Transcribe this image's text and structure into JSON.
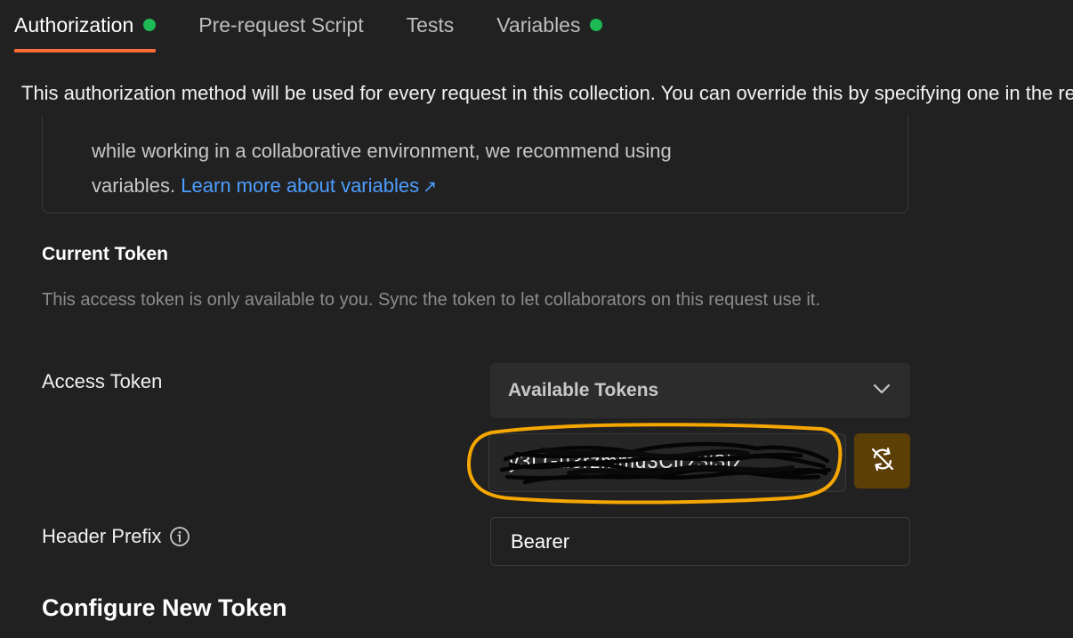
{
  "tabs": [
    {
      "label": "Authorization",
      "active": true,
      "has_dot": true
    },
    {
      "label": "Pre-request Script",
      "active": false,
      "has_dot": false
    },
    {
      "label": "Tests",
      "active": false,
      "has_dot": false
    },
    {
      "label": "Variables",
      "active": false,
      "has_dot": true
    }
  ],
  "info_text": "This authorization method will be used for every request in this collection. You can override this by specifying one in the request.",
  "notice": {
    "line1": "while working in a collaborative environment, we recommend using",
    "line2_prefix": "variables.",
    "link_text": "Learn more about variables",
    "link_arrow": "↗"
  },
  "current_token": {
    "title": "Current Token",
    "description": "This access token is only available to you. Sync the token to let collaborators on this request use it."
  },
  "access_token": {
    "label": "Access Token",
    "dropdown_label": "Available Tokens",
    "value": "y3LGu3rzmmd3Cirz3l3Iz"
  },
  "header_prefix": {
    "label": "Header Prefix",
    "value": "Bearer"
  },
  "configure": {
    "title": "Configure New Token"
  },
  "colors": {
    "accent_orange": "#ff6c37",
    "status_green": "#1db954",
    "link_blue": "#4d9eff",
    "highlight_ring": "#f5a700",
    "sync_button_bg": "#5c3e07",
    "background": "#212121"
  },
  "icons": {
    "dropdown": "chevron-down-icon",
    "sync": "sync-off-icon",
    "info": "info-icon",
    "external_link": "arrow-up-right-icon"
  }
}
